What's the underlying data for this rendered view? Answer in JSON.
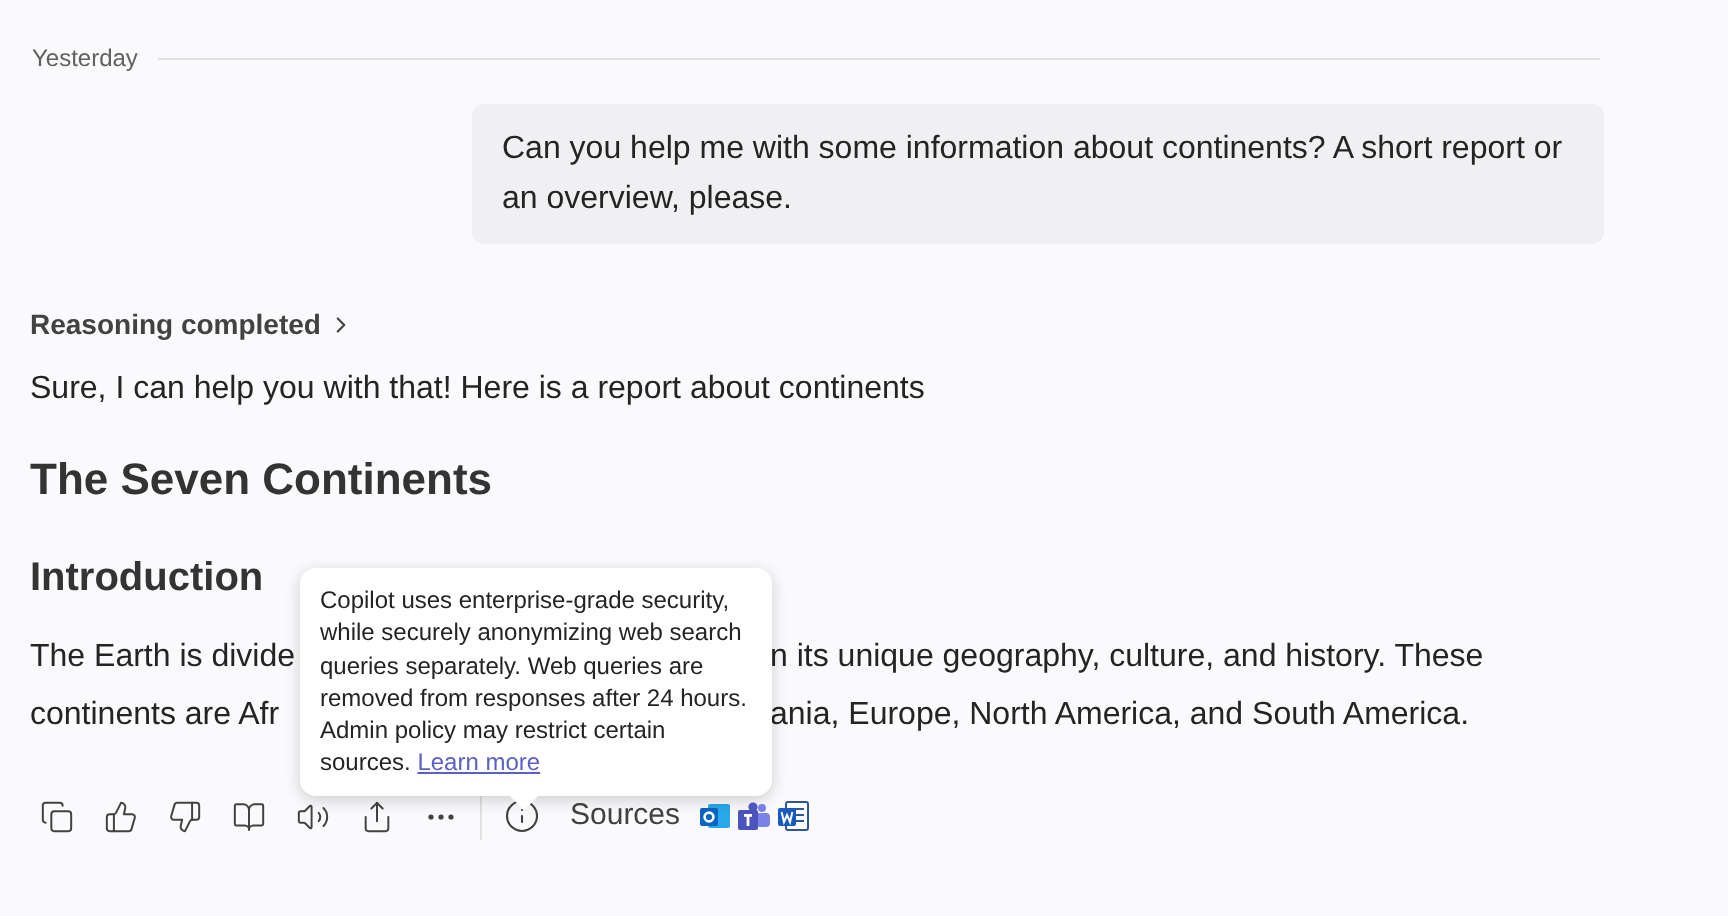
{
  "divider_label": "Yesterday",
  "user_message": "Can you help me with some information about continents? A short report or an overview, please.",
  "reasoning": {
    "label": "Reasoning completed",
    "expanded": false
  },
  "intro_sentence": "Sure, I can help you with that! Here is a report about continents",
  "title": "The Seven Continents",
  "section_heading": "Introduction",
  "paragraph_lines": [
    {
      "left": "The Earth is divide",
      "right": "n its unique geography, culture, and history. These"
    },
    {
      "left": "continents are Afr",
      "right": "ania, Europe, North America, and South America."
    }
  ],
  "tooltip": {
    "text": "Copilot uses enterprise-grade security, while securely anonymizing web search queries separately. Web queries are removed from responses after 24 hours. Admin policy may restrict certain sources.",
    "link": "Learn more"
  },
  "toolbar": {
    "sources_label": "Sources"
  }
}
